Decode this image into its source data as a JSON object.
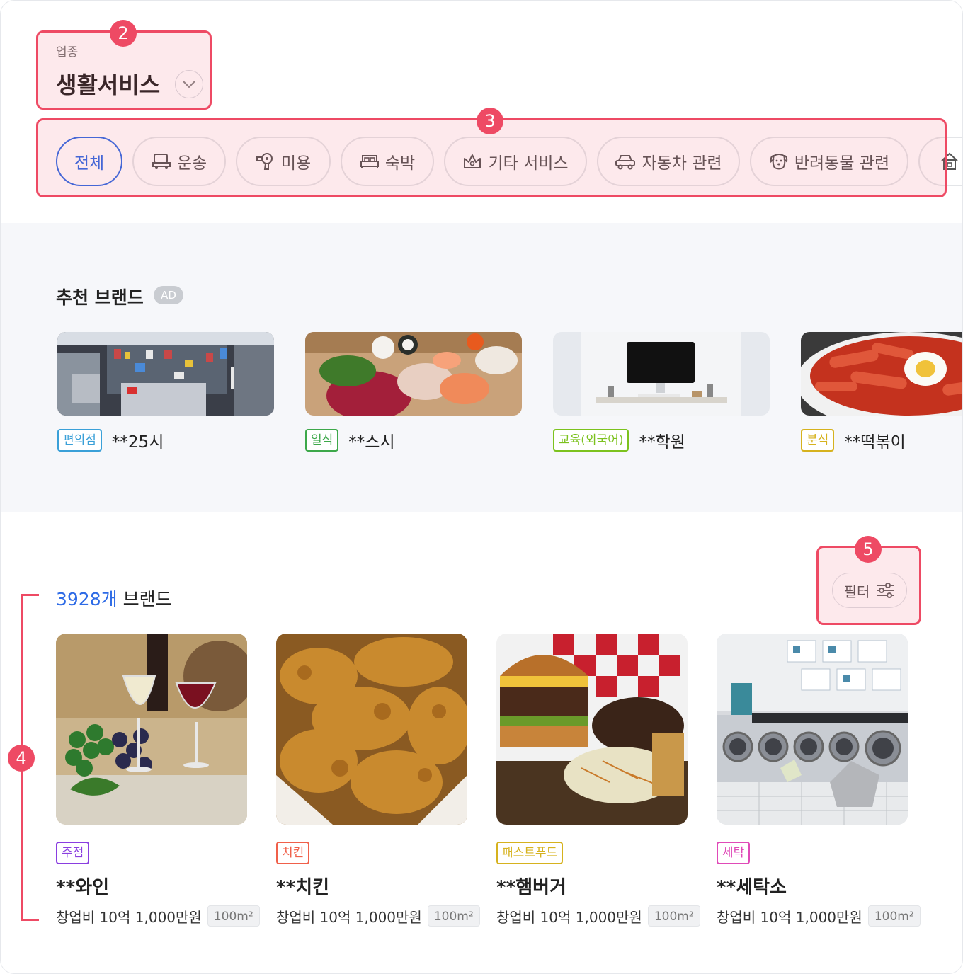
{
  "industry": {
    "label": "업종",
    "value": "생활서비스"
  },
  "categories": [
    {
      "label": "전체",
      "icon": "none",
      "active": true
    },
    {
      "label": "운송",
      "icon": "truck-icon"
    },
    {
      "label": "미용",
      "icon": "hair-dryer-icon"
    },
    {
      "label": "숙박",
      "icon": "bed-icon"
    },
    {
      "label": "기타 서비스",
      "icon": "crown-icon"
    },
    {
      "label": "자동차 관련",
      "icon": "car-icon"
    },
    {
      "label": "반려동물 관련",
      "icon": "dog-icon"
    },
    {
      "label": "",
      "icon": "house-icon"
    }
  ],
  "recommended": {
    "title": "추천 브랜드",
    "ad_label": "AD",
    "items": [
      {
        "tag": "편의점",
        "tag_color": "#3aa0d8",
        "name": "**25시",
        "image": "convenience-store-photo"
      },
      {
        "tag": "일식",
        "tag_color": "#3da84a",
        "name": "**스시",
        "image": "sushi-photo"
      },
      {
        "tag": "교육(외국어)",
        "tag_color": "#7cc21e",
        "name": "**학원",
        "image": "computer-desk-photo"
      },
      {
        "tag": "분식",
        "tag_color": "#d6b21e",
        "name": "**떡볶이",
        "image": "tteokbokki-photo"
      }
    ]
  },
  "brands": {
    "count": "3928개",
    "count_suffix": " 브랜드",
    "filter_label": "필터",
    "items": [
      {
        "tag": "주점",
        "tag_color": "#8a3ee0",
        "name": "**와인",
        "cost": "창업비 10억 1,000만원",
        "area": "100m²",
        "image": "wine-photo"
      },
      {
        "tag": "치킨",
        "tag_color": "#f0604a",
        "name": "**치킨",
        "cost": "창업비 10억 1,000만원",
        "area": "100m²",
        "image": "fried-chicken-photo"
      },
      {
        "tag": "패스트푸드",
        "tag_color": "#d6b21e",
        "name": "**햄버거",
        "cost": "창업비 10억 1,000만원",
        "area": "100m²",
        "image": "hamburger-photo"
      },
      {
        "tag": "세탁",
        "tag_color": "#e04ab8",
        "name": "**세탁소",
        "cost": "창업비 10억 1,000만원",
        "area": "100m²",
        "image": "laundromat-photo"
      }
    ]
  },
  "annotations": [
    "2",
    "3",
    "4",
    "5"
  ],
  "colors": {
    "accent": "#2e6be6",
    "annotation": "#ee4a64",
    "section_bg": "#f6f7fa"
  }
}
